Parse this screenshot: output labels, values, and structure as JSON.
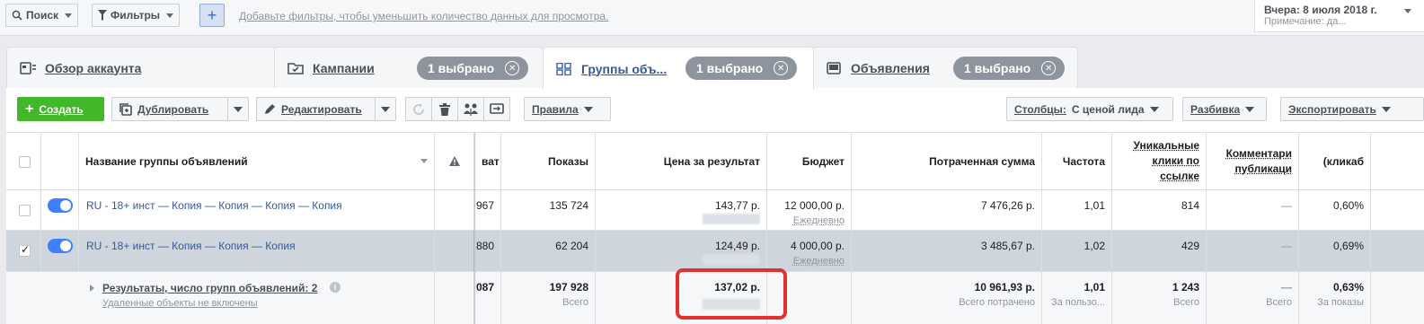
{
  "filterbar": {
    "search_label": "Поиск",
    "filters_label": "Фильтры",
    "add_label": "+",
    "hint": "Добавьте фильтры, чтобы уменьшить количество данных для просмотра.",
    "date_main": "Вчера: 8 июля 2018 г.",
    "date_note": "Примечание: да..."
  },
  "tabs": [
    {
      "label": "Обзор аккаунта",
      "pill": ""
    },
    {
      "label": "Кампании",
      "pill": "1 выбрано"
    },
    {
      "label": "Группы объ...",
      "pill": "1 выбрано"
    },
    {
      "label": "Объявления",
      "pill": "1 выбрано"
    }
  ],
  "toolbar": {
    "create": "Создать",
    "duplicate": "Дублировать",
    "edit": "Редактировать",
    "rules": "Правила",
    "columns_prefix": "Столбцы:",
    "columns_value": "С ценой лида",
    "breakdown": "Разбивка",
    "export": "Экспортировать"
  },
  "table": {
    "headers": {
      "name": "Название группы объявлений",
      "reach": "ват",
      "impressions": "Показы",
      "cost": "Цена за результат",
      "budget": "Бюджет",
      "spent": "Потраченная сумма",
      "frequency": "Частота",
      "unique_clicks": "Уникальные клики по ссылке",
      "comments": "Комментари публикаци",
      "ctr": "(кликаб"
    },
    "rows": [
      {
        "name": "RU - 18+ инст — Копия — Копия — Копия — Копия",
        "reach": "967",
        "impressions": "135 724",
        "cost": "143,77 р.",
        "budget": "12 000,00 р.",
        "budget_type": "Ежедневно",
        "spent": "7 476,26 р.",
        "frequency": "1,01",
        "unique_clicks": "814",
        "comments": "—",
        "ctr": "0,60%"
      },
      {
        "name": "RU - 18+ инст — Копия — Копия — Копия",
        "reach": "880",
        "impressions": "62 204",
        "cost": "124,49 р.",
        "budget": "4 000,00 р.",
        "budget_type": "Ежедневно",
        "spent": "3 485,67 р.",
        "frequency": "1,02",
        "unique_clicks": "429",
        "comments": "—",
        "ctr": "0,69%"
      }
    ],
    "totals": {
      "title": "Результаты, число групп объявлений: 2",
      "note": "Удаленные объекты не включены",
      "reach": "087",
      "impressions": "197 928",
      "impressions_sub": "Всего",
      "cost": "137,02 р.",
      "spent": "10 961,93 р.",
      "spent_sub": "Всего потрачено",
      "frequency": "1,01",
      "frequency_sub": "За пользо...",
      "unique_clicks": "1 243",
      "unique_clicks_sub": "Всего",
      "comments": "—",
      "comments_sub": "Всего",
      "ctr": "0,63%",
      "ctr_sub": "За показы"
    }
  },
  "colors": {
    "accent": "#4267b2",
    "create_green": "#42b72a",
    "highlight_red": "#e0332f",
    "selected_row": "#cfd5dd"
  }
}
